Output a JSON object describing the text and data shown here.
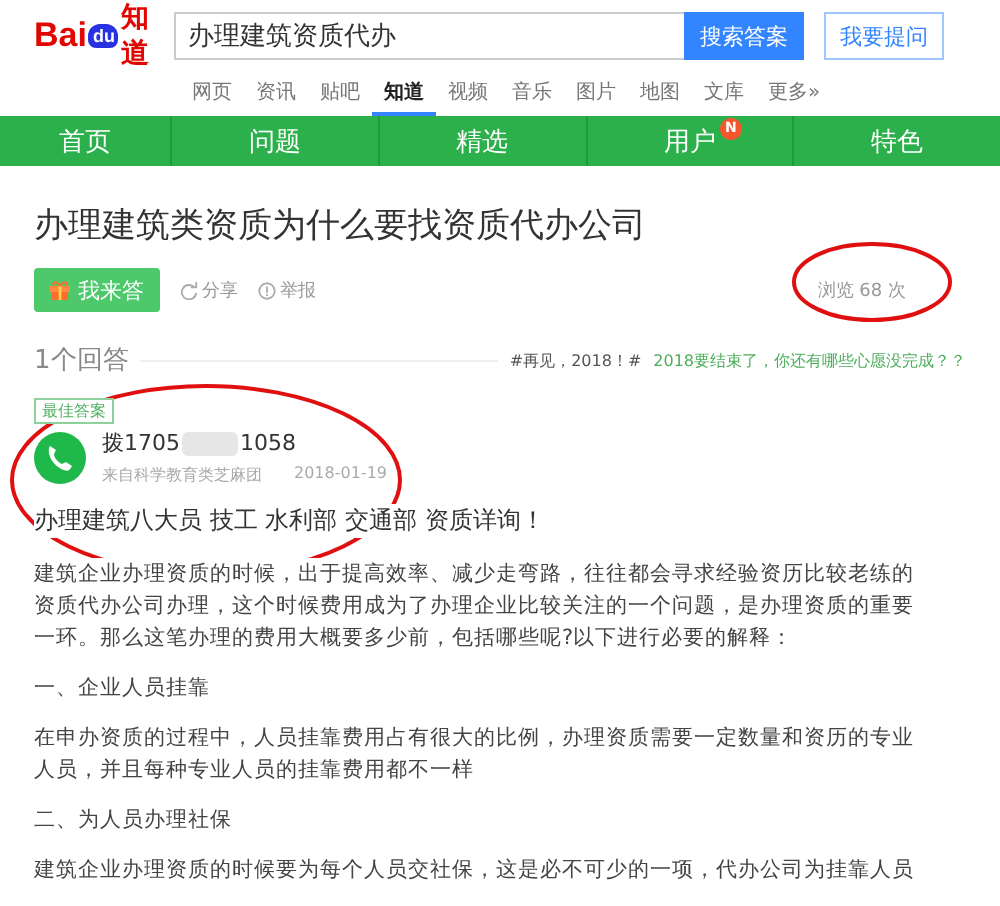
{
  "header": {
    "logo": {
      "latin": "Bai",
      "du": "du",
      "cjk": "知道"
    },
    "search": {
      "value": "办理建筑资质代办"
    },
    "search_button": "搜索答案",
    "ask_button": "我要提问"
  },
  "nav_tabs": [
    {
      "label": "网页",
      "selected": false
    },
    {
      "label": "资讯",
      "selected": false
    },
    {
      "label": "贴吧",
      "selected": false
    },
    {
      "label": "知道",
      "selected": true
    },
    {
      "label": "视频",
      "selected": false
    },
    {
      "label": "音乐",
      "selected": false
    },
    {
      "label": "图片",
      "selected": false
    },
    {
      "label": "地图",
      "selected": false
    },
    {
      "label": "文库",
      "selected": false
    },
    {
      "label": "更多»",
      "selected": false
    }
  ],
  "menu": [
    {
      "label": "首页"
    },
    {
      "label": "问题"
    },
    {
      "label": "精选"
    },
    {
      "label": "用户",
      "badge": "N"
    },
    {
      "label": "特色"
    }
  ],
  "question": {
    "title": "办理建筑类资质为什么要找资质代办公司",
    "answer_button": "我来答",
    "share": "分享",
    "report": "举报",
    "views": "浏览 68 次"
  },
  "answers_header": {
    "count": "1个回答",
    "topic": "#再见，2018！#",
    "topic_link": "2018要结束了，你还有哪些心愿没完成？？"
  },
  "answer": {
    "tag": "最佳答案",
    "user_prefix": "拨1705",
    "user_suffix": "1058",
    "source": "来自科学教育类芝麻团",
    "date": "2018-01-19",
    "headline": "办理建筑八大员 技工 水利部 交通部 资质详询！",
    "paragraphs": [
      "建筑企业办理资质的时候，出于提高效率、减少走弯路，往往都会寻求经验资历比较老练的资质代办公司办理，这个时候费用成为了办理企业比较关注的一个问题，是办理资质的重要一环。那么这笔办理的费用大概要多少前，包括哪些呢?以下进行必要的解释：",
      "一、企业人员挂靠",
      "在申办资质的过程中，人员挂靠费用占有很大的比例，办理资质需要一定数量和资历的专业人员，并且每种专业人员的挂靠费用都不一样",
      "二、为人员办理社保",
      "建筑企业办理资质的时候要为每个人员交社保，这是必不可少的一项，代办公司为挂靠人员"
    ]
  }
}
